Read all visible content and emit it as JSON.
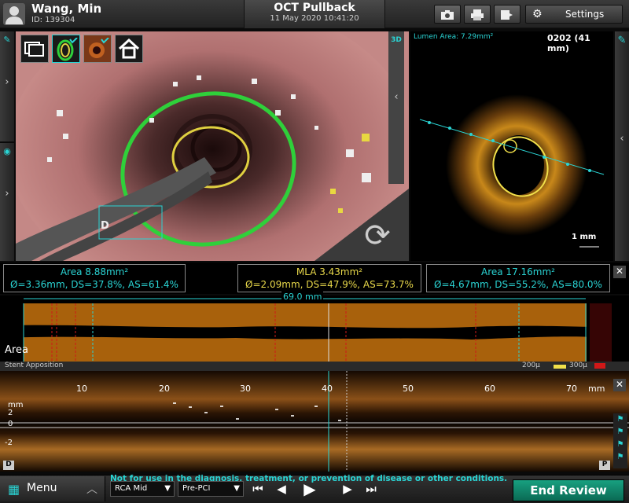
{
  "header": {
    "patient_name": "Wang, Min",
    "patient_id": "ID: 139304",
    "title": "OCT Pullback",
    "datetime": "11 May 2020 10:41:20",
    "settings_label": "Settings",
    "tool_icons": [
      "camera-icon",
      "printer-icon",
      "export-icon"
    ]
  },
  "view3d": {
    "tools": [
      "layout-icon",
      "stent-toggle-icon",
      "lumen-toggle-icon",
      "home-icon"
    ],
    "badge_3d": "3D",
    "marker_label": "D"
  },
  "octview": {
    "lumen_area": "Lumen Area: 7.29mm²",
    "frame_label": "0202 (41 mm)",
    "scale_label": "1 mm"
  },
  "measurements": {
    "left": {
      "title": "Area 8.88mm²",
      "detail": "Ø=3.36mm, DS=37.8%, AS=61.4%",
      "color": "#2ad4d4"
    },
    "center": {
      "title": "MLA 3.43mm²",
      "detail": "Ø=2.09mm, DS=47.9%, AS=73.7%",
      "color": "#e8d84a"
    },
    "right": {
      "title": "Area 17.16mm²",
      "detail": "Ø=4.67mm, DS=55.2%, AS=80.0%",
      "color": "#2ad4d4"
    },
    "length": "69.0 mm"
  },
  "track": {
    "label": "Area"
  },
  "apposition": {
    "label": "Stent Apposition",
    "legend": [
      "200µ",
      "300µ"
    ],
    "colors": [
      "#ffffff",
      "#f2e04a",
      "#d01818"
    ]
  },
  "lview": {
    "ticks": [
      "10",
      "20",
      "30",
      "40",
      "50",
      "60",
      "70"
    ],
    "unit": "mm",
    "y_unit": "mm",
    "y_ticks": [
      "2",
      "0",
      "-2"
    ],
    "left_marker": "D",
    "right_marker": "P"
  },
  "footer": {
    "menu_label": "Menu",
    "disclaimer": "Not for use in the diagnosis, treatment, or prevention of disease or other conditions.",
    "vessel": "RCA Mid",
    "phase": "Pre-PCI",
    "end_review": "End Review"
  }
}
